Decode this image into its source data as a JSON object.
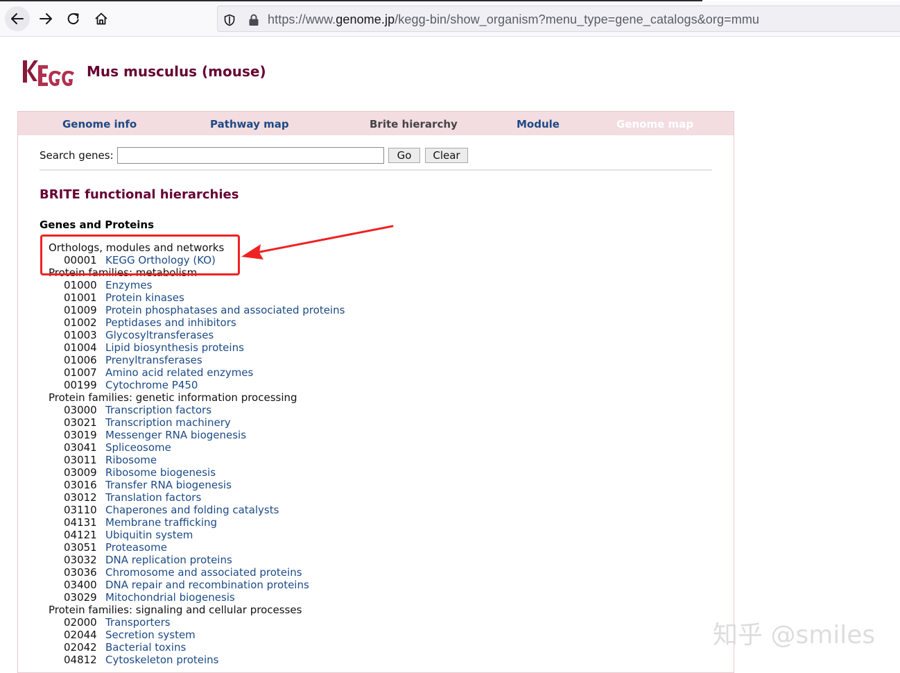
{
  "browser": {
    "url_prefix": "https://www.",
    "url_host": "genome.jp",
    "url_path": "/kegg-bin/show_organism?menu_type=gene_catalogs&org=mmu"
  },
  "header": {
    "logo_alt": "KEGG",
    "organism_title": "Mus musculus (mouse)"
  },
  "tabs": [
    {
      "label": "Genome info",
      "state": "link"
    },
    {
      "label": "Pathway map",
      "state": "link"
    },
    {
      "label": "Brite hierarchy",
      "state": "plain"
    },
    {
      "label": "Module",
      "state": "link"
    },
    {
      "label": "Genome map",
      "state": "disabled"
    }
  ],
  "search": {
    "label": "Search genes:",
    "value": "",
    "go_label": "Go",
    "clear_label": "Clear"
  },
  "main": {
    "section_title": "BRITE functional hierarchies",
    "subhead": "Genes and Proteins"
  },
  "brite_groups": [
    {
      "category": "Orthologs, modules and networks",
      "entries": [
        {
          "code": "00001",
          "name": "KEGG Orthology (KO)"
        }
      ]
    },
    {
      "category": "Protein families: metabolism",
      "entries": [
        {
          "code": "01000",
          "name": "Enzymes"
        },
        {
          "code": "01001",
          "name": "Protein kinases"
        },
        {
          "code": "01009",
          "name": "Protein phosphatases and associated proteins"
        },
        {
          "code": "01002",
          "name": "Peptidases and inhibitors"
        },
        {
          "code": "01003",
          "name": "Glycosyltransferases"
        },
        {
          "code": "01004",
          "name": "Lipid biosynthesis proteins"
        },
        {
          "code": "01006",
          "name": "Prenyltransferases"
        },
        {
          "code": "01007",
          "name": "Amino acid related enzymes"
        },
        {
          "code": "00199",
          "name": "Cytochrome P450"
        }
      ]
    },
    {
      "category": "Protein families: genetic information processing",
      "entries": [
        {
          "code": "03000",
          "name": "Transcription factors"
        },
        {
          "code": "03021",
          "name": "Transcription machinery"
        },
        {
          "code": "03019",
          "name": "Messenger RNA biogenesis"
        },
        {
          "code": "03041",
          "name": "Spliceosome"
        },
        {
          "code": "03011",
          "name": "Ribosome"
        },
        {
          "code": "03009",
          "name": "Ribosome biogenesis"
        },
        {
          "code": "03016",
          "name": "Transfer RNA biogenesis"
        },
        {
          "code": "03012",
          "name": "Translation factors"
        },
        {
          "code": "03110",
          "name": "Chaperones and folding catalysts"
        },
        {
          "code": "04131",
          "name": "Membrane trafficking"
        },
        {
          "code": "04121",
          "name": "Ubiquitin system"
        },
        {
          "code": "03051",
          "name": "Proteasome"
        },
        {
          "code": "03032",
          "name": "DNA replication proteins"
        },
        {
          "code": "03036",
          "name": "Chromosome and associated proteins"
        },
        {
          "code": "03400",
          "name": "DNA repair and recombination proteins"
        },
        {
          "code": "03029",
          "name": "Mitochondrial biogenesis"
        }
      ]
    },
    {
      "category": "Protein families: signaling and cellular processes",
      "entries": [
        {
          "code": "02000",
          "name": "Transporters"
        },
        {
          "code": "02044",
          "name": "Secretion system"
        },
        {
          "code": "02042",
          "name": "Bacterial toxins"
        },
        {
          "code": "04812",
          "name": "Cytoskeleton proteins"
        }
      ]
    }
  ],
  "annotation": {
    "box_color": "#ee2222"
  },
  "watermark": "知乎 @smiles",
  "colors": {
    "title": "#660033",
    "link": "#1c4a86",
    "tabbar": "#f3dde0"
  }
}
